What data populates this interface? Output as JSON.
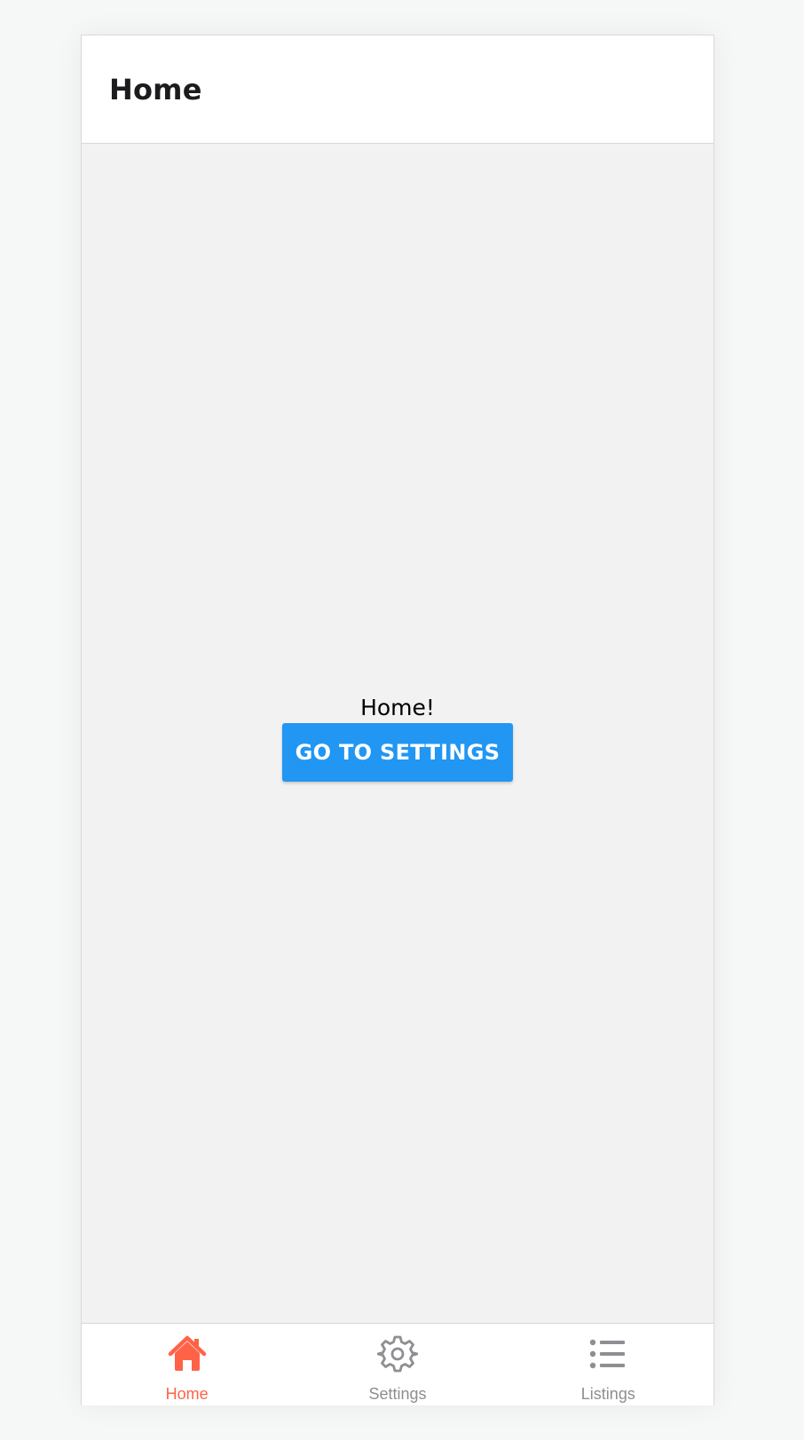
{
  "header": {
    "title": "Home"
  },
  "main": {
    "text": "Home!",
    "button_label": "GO TO SETTINGS"
  },
  "tabs": [
    {
      "label": "Home",
      "icon": "home-icon",
      "active": true
    },
    {
      "label": "Settings",
      "icon": "gear-icon",
      "active": false
    },
    {
      "label": "Listings",
      "icon": "list-icon",
      "active": false
    }
  ],
  "colors": {
    "accent": "#ff6347",
    "button": "#2196f3",
    "inactive": "#8e8e93"
  }
}
